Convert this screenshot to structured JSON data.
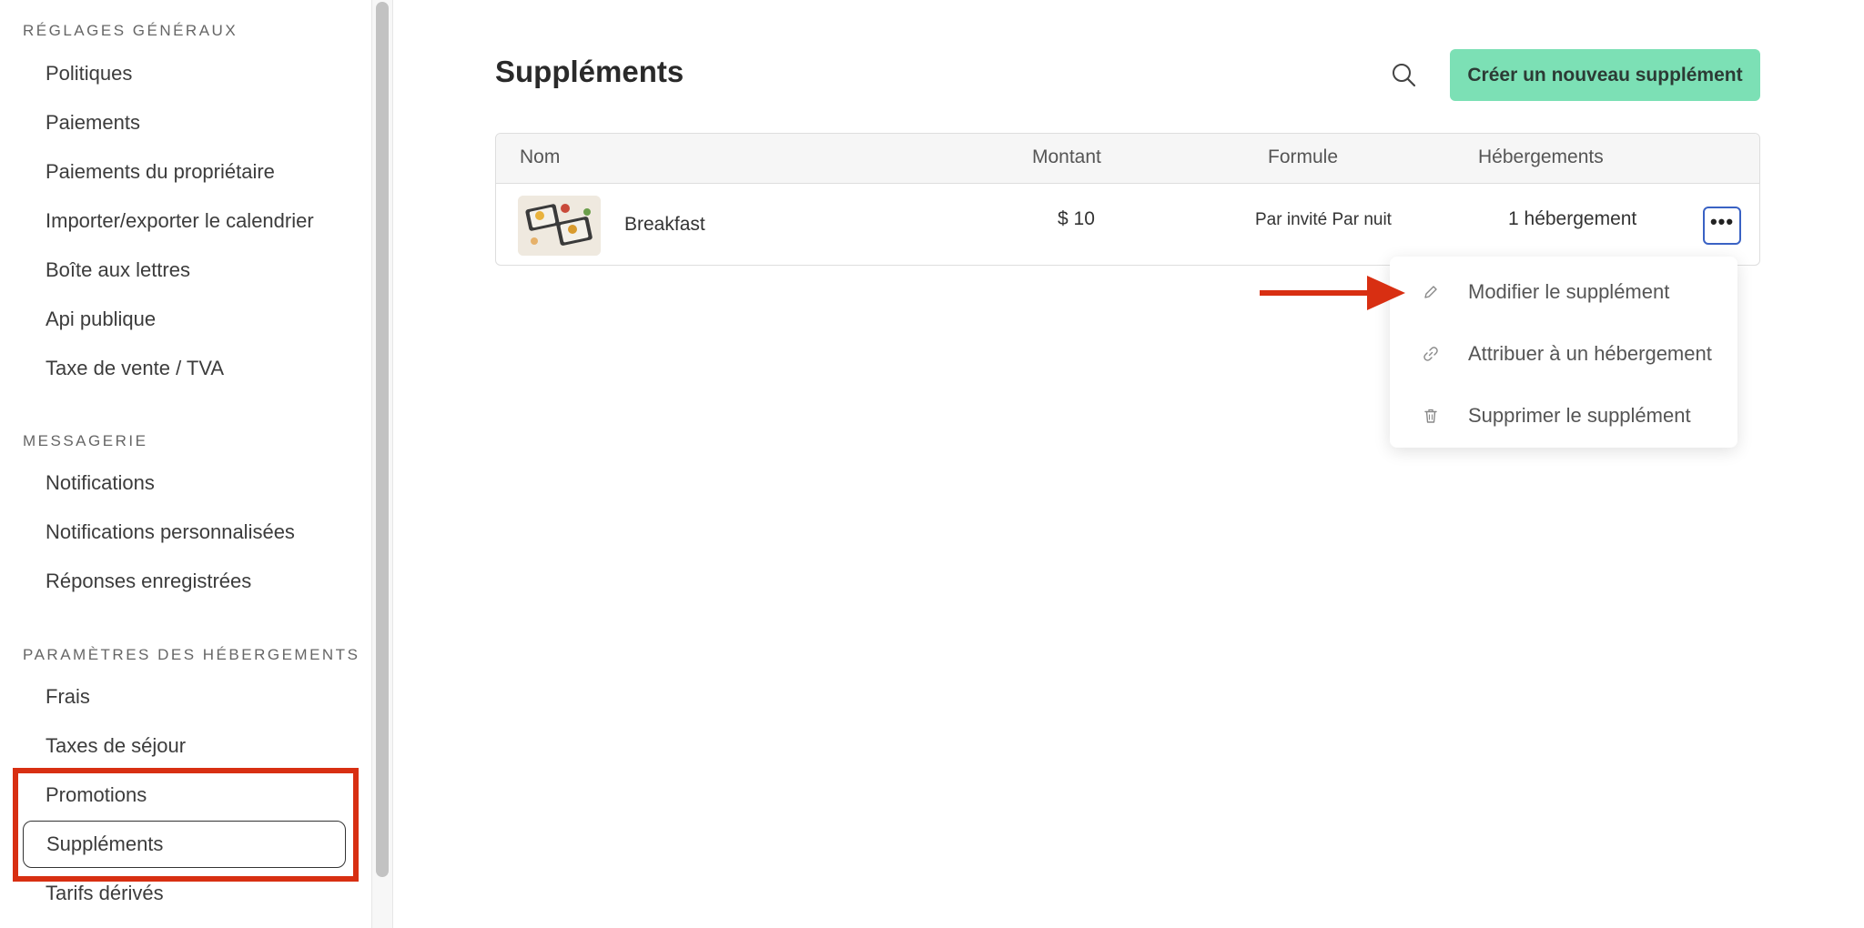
{
  "sidebar": {
    "sections": [
      {
        "title": "RÉGLAGES GÉNÉRAUX",
        "items": [
          "Politiques",
          "Paiements",
          "Paiements du propriétaire",
          "Importer/exporter le calendrier",
          "Boîte aux lettres",
          "Api publique",
          "Taxe de vente / TVA"
        ]
      },
      {
        "title": "MESSAGERIE",
        "items": [
          "Notifications",
          "Notifications personnalisées",
          "Réponses enregistrées"
        ]
      },
      {
        "title": "PARAMÈTRES DES HÉBERGEMENTS",
        "items": [
          "Frais",
          "Taxes de séjour",
          "Promotions",
          "Suppléments",
          "Tarifs dérivés"
        ]
      }
    ],
    "active_item": "Suppléments"
  },
  "main": {
    "title": "Suppléments",
    "create_button": "Créer un nouveau supplément",
    "table": {
      "headers": [
        "Nom",
        "Montant",
        "Formule",
        "Hébergements"
      ],
      "rows": [
        {
          "name": "Breakfast",
          "amount": "$ 10",
          "formula": "Par invité Par nuit",
          "accommodations": "1 hébergement"
        }
      ]
    },
    "dropdown": {
      "items": [
        {
          "label": "Modifier le supplément",
          "icon": "pencil-icon"
        },
        {
          "label": "Attribuer à un hébergement",
          "icon": "link-icon"
        },
        {
          "label": "Supprimer le supplément",
          "icon": "trash-icon"
        }
      ]
    }
  },
  "colors": {
    "accent_green": "#7ce0b5",
    "annotation_red": "#d82f12",
    "focus_blue": "#3a62c4"
  }
}
